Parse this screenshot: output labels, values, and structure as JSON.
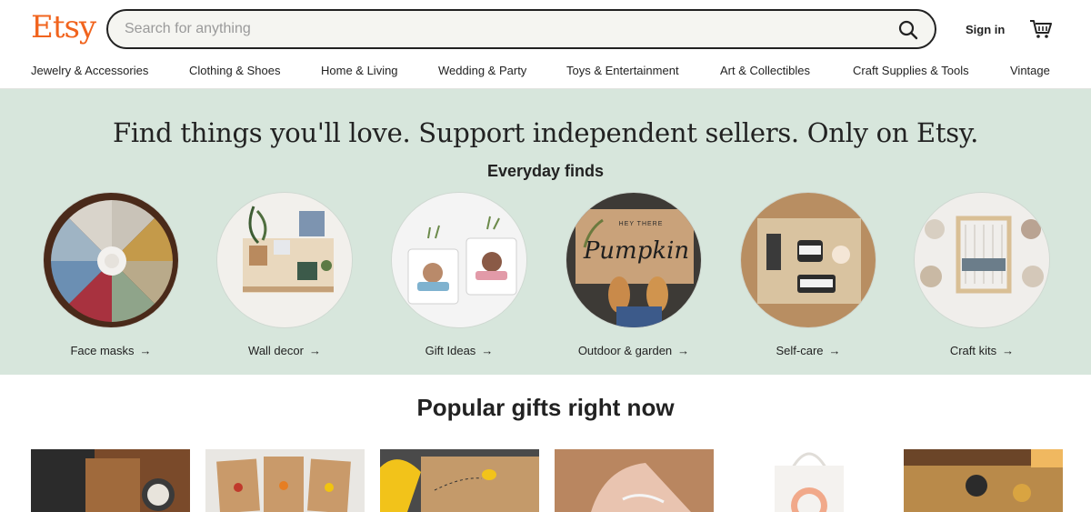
{
  "header": {
    "logo": "Etsy",
    "search_placeholder": "Search for anything",
    "search_value": "",
    "signin_label": "Sign in",
    "icons": {
      "search": "search-icon",
      "cart": "cart-icon"
    },
    "brand_color": "#f1641e"
  },
  "categories": [
    "Jewelry & Accessories",
    "Clothing & Shoes",
    "Home & Living",
    "Wedding & Party",
    "Toys & Entertainment",
    "Art & Collectibles",
    "Craft Supplies & Tools",
    "Vintage"
  ],
  "hero": {
    "title": "Find things you'll love. Support independent sellers. Only on Etsy.",
    "subtitle": "Everyday finds",
    "background": "#d7e6dc",
    "items": [
      {
        "label": "Face masks",
        "arrow": "→"
      },
      {
        "label": "Wall decor",
        "arrow": "→"
      },
      {
        "label": "Gift Ideas",
        "arrow": "→"
      },
      {
        "label": "Outdoor & garden",
        "arrow": "→"
      },
      {
        "label": "Self-care",
        "arrow": "→"
      },
      {
        "label": "Craft kits",
        "arrow": "→"
      }
    ],
    "image_texts": {
      "doormat_small": "HEY THERE",
      "doormat_big": "Pumpkin"
    }
  },
  "popular": {
    "title": "Popular gifts right now"
  }
}
